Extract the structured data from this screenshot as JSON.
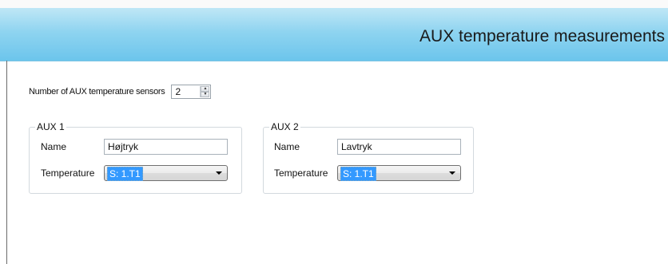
{
  "header": {
    "title": "AUX temperature measurements"
  },
  "sensors": {
    "label": "Number of AUX temperature sensors",
    "value": "2"
  },
  "aux_groups": [
    {
      "legend": "AUX 1",
      "name_label": "Name",
      "name_value": "Højtryk",
      "temperature_label": "Temperature",
      "temperature_value": "S: 1.T1"
    },
    {
      "legend": "AUX 2",
      "name_label": "Name",
      "name_value": "Lavtryk",
      "temperature_label": "Temperature",
      "temperature_value": "S: 1.T1"
    }
  ],
  "icons": {
    "spin_up": "up-arrow-icon",
    "spin_down": "down-arrow-icon",
    "dropdown": "chevron-down-icon"
  },
  "colors": {
    "header_gradient_top": "#bfe7f6",
    "header_gradient_bottom": "#6cc5ec",
    "selection": "#3399ff"
  }
}
